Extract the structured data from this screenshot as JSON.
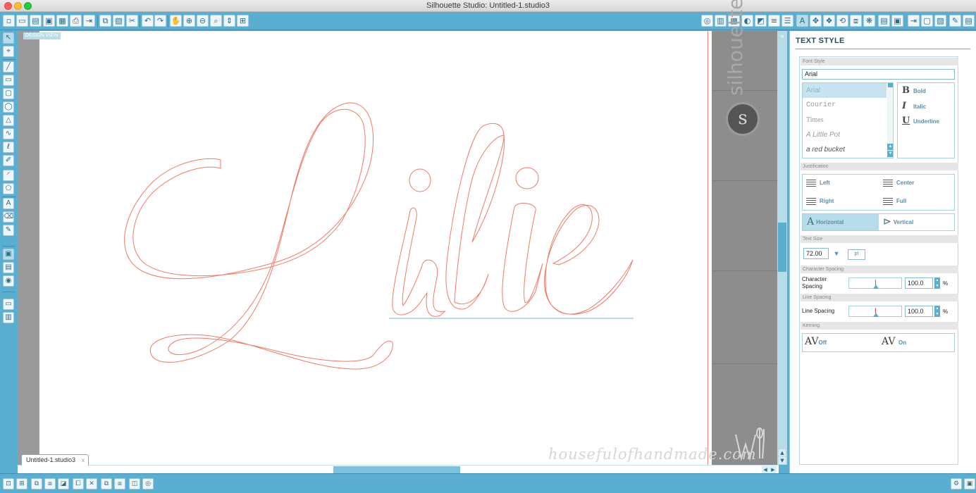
{
  "window": {
    "title": "Silhouette Studio: Untitled-1.studio3"
  },
  "canvas": {
    "view_label": "DESIGN VIEW",
    "text_content": "Lilie",
    "brand_text": "silhouette",
    "watermark": "housefulofhandmade.com",
    "document_tab": "Untitled-1.studio3",
    "colors": {
      "outline": "#f07a66",
      "baseline": "#6cb4d4",
      "accent": "#5aaed0"
    }
  },
  "panel": {
    "title": "TEXT STYLE",
    "font_style": {
      "header": "Font Style",
      "current_font": "Arial",
      "fonts": [
        "Arial",
        "Courier",
        "Times",
        "A Little Pot",
        "a red bucket"
      ],
      "styles": [
        {
          "glyph": "B",
          "label": "Bold"
        },
        {
          "glyph": "I",
          "label": "Italic"
        },
        {
          "glyph": "U",
          "label": "Underline"
        }
      ]
    },
    "justification": {
      "header": "Justification",
      "left": "Left",
      "center": "Center",
      "right": "Right",
      "full": "Full",
      "horizontal": "Horizontal",
      "vertical": "Vertical"
    },
    "text_size": {
      "header": "Text Size",
      "value": "72.00",
      "unit": "pt"
    },
    "character_spacing": {
      "header": "Character Spacing",
      "label": "Character Spacing",
      "value": "100.0",
      "unit": "%"
    },
    "line_spacing": {
      "header": "Line Spacing",
      "label": "Line Spacing",
      "value": "100.0",
      "unit": "%"
    },
    "kerning": {
      "header": "Kerning",
      "off": "Off",
      "on": "On"
    }
  }
}
